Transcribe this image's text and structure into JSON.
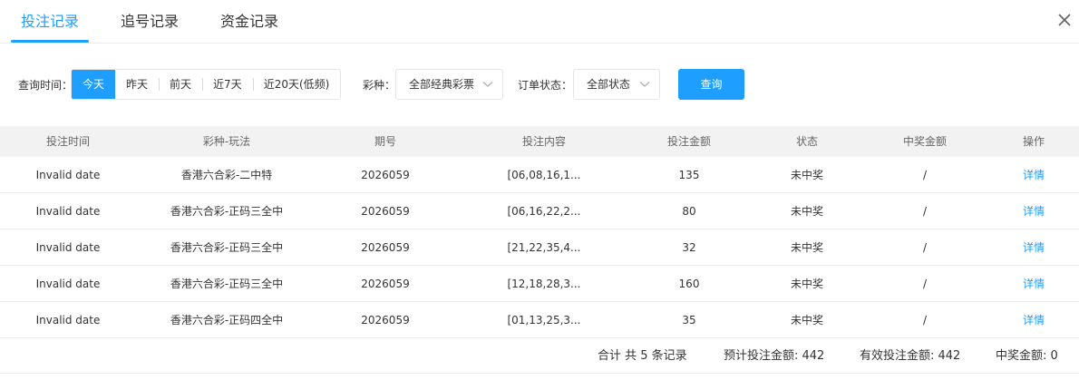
{
  "tabs": [
    "投注记录",
    "追号记录",
    "资金记录"
  ],
  "filters": {
    "time_label": "查询时间：",
    "time_options": [
      "今天",
      "昨天",
      "前天",
      "近7天",
      "近20天(低频)"
    ],
    "lottery_label": "彩种：",
    "lottery_value": "全部经典彩票",
    "status_label": "订单状态：",
    "status_value": "全部状态",
    "query_label": "查询"
  },
  "table": {
    "columns": [
      "投注时间",
      "彩种-玩法",
      "期号",
      "投注内容",
      "投注金额",
      "状态",
      "中奖金额",
      "操作"
    ],
    "rows": [
      [
        "Invalid date",
        "香港六合彩-二中特",
        "2026059",
        "[06,08,16,1...",
        "135",
        "未中奖",
        "/",
        "详情"
      ],
      [
        "Invalid date",
        "香港六合彩-正码三全中",
        "2026059",
        "[06,16,22,2...",
        "80",
        "未中奖",
        "/",
        "详情"
      ],
      [
        "Invalid date",
        "香港六合彩-正码三全中",
        "2026059",
        "[21,22,35,4...",
        "32",
        "未中奖",
        "/",
        "详情"
      ],
      [
        "Invalid date",
        "香港六合彩-正码三全中",
        "2026059",
        "[12,18,28,3...",
        "160",
        "未中奖",
        "/",
        "详情"
      ],
      [
        "Invalid date",
        "香港六合彩-正码四全中",
        "2026059",
        "[01,13,25,3...",
        "35",
        "未中奖",
        "/",
        "详情"
      ]
    ]
  },
  "summary": {
    "count_text": "合计 共 5 条记录",
    "expected_text": "预计投注金额: 442",
    "valid_text": "有效投注金额: 442",
    "win_text": "中奖金额: 0"
  },
  "colors": {
    "accent": "#1e9fff",
    "header_bg": "#f2f2f2",
    "divider": "#ececec"
  },
  "icons": [
    "close-icon",
    "chevron-down-icon"
  ]
}
